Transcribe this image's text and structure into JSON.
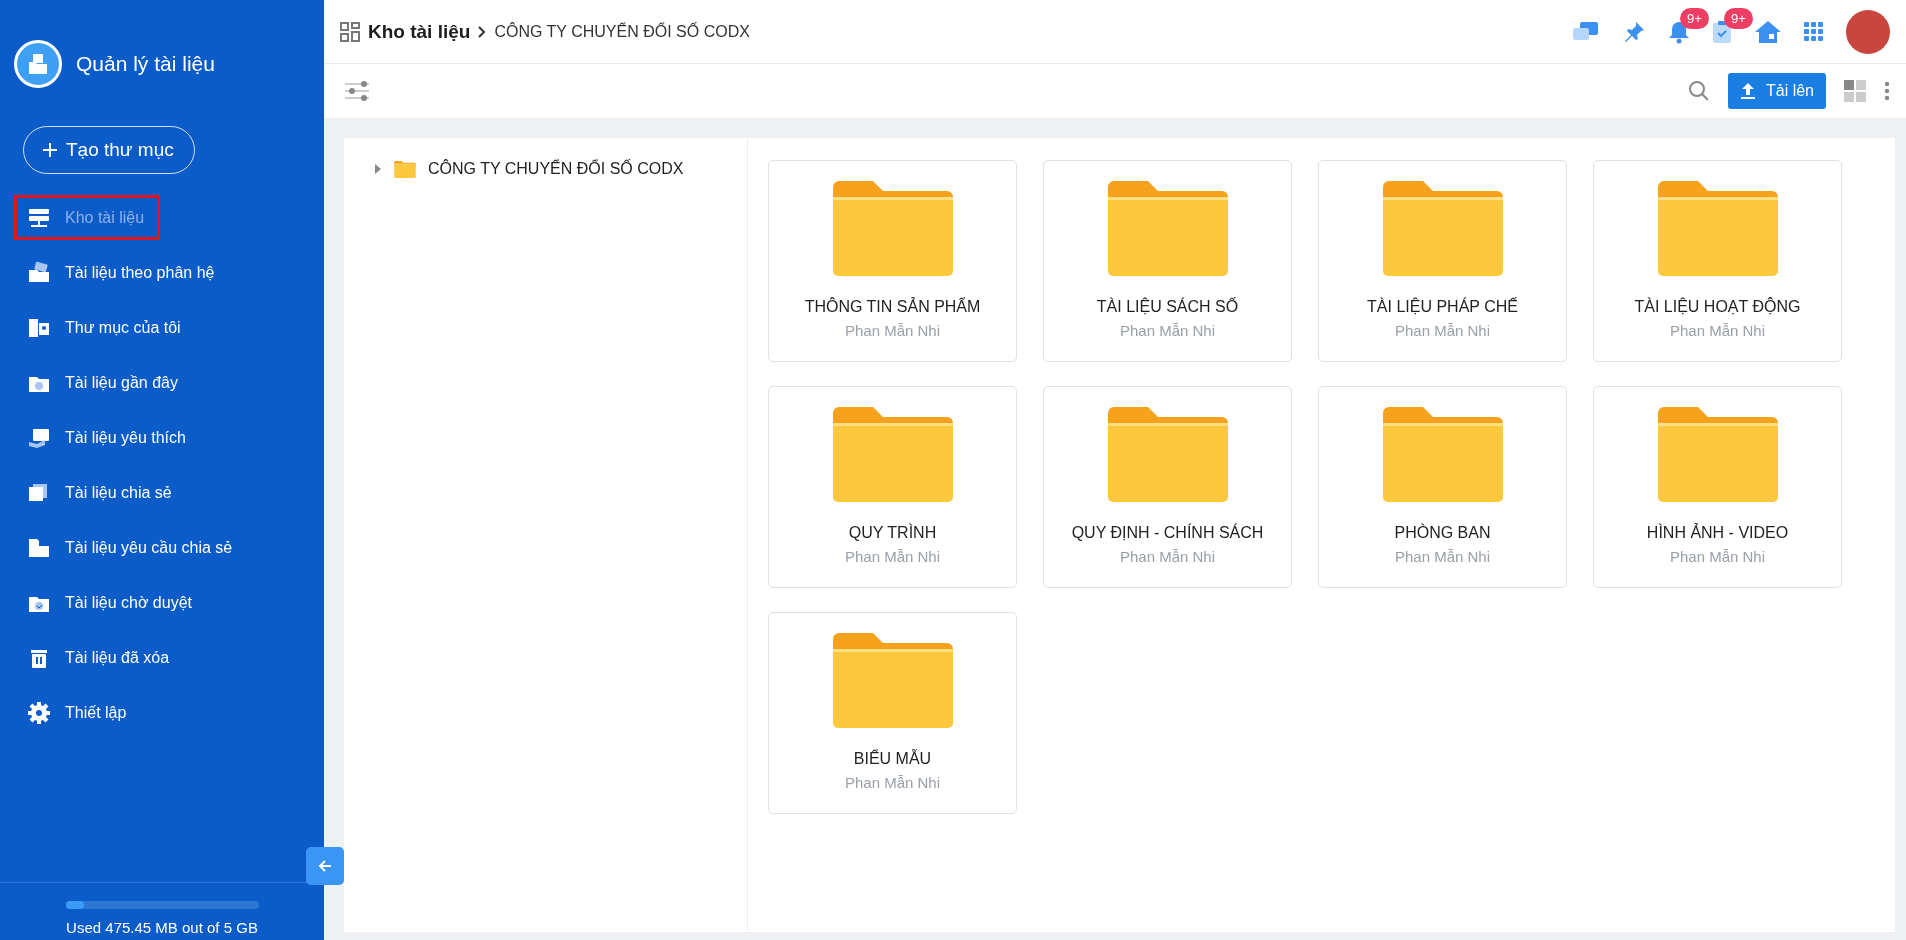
{
  "sidebar": {
    "title": "Quản lý tài liệu",
    "create_button": "Tạo thư mục",
    "items": [
      {
        "label": "Kho tài liệu",
        "selected": true
      },
      {
        "label": "Tài liệu theo phân hệ",
        "selected": false
      },
      {
        "label": "Thư mục của tôi",
        "selected": false
      },
      {
        "label": "Tài liệu gần đây",
        "selected": false
      },
      {
        "label": "Tài liệu yêu thích",
        "selected": false
      },
      {
        "label": "Tài liệu chia sẻ",
        "selected": false
      },
      {
        "label": "Tài liệu yêu cầu chia sẻ",
        "selected": false
      },
      {
        "label": "Tài liệu chờ duyệt",
        "selected": false
      },
      {
        "label": "Tài liệu đã xóa",
        "selected": false
      },
      {
        "label": "Thiết lập",
        "selected": false
      }
    ],
    "storage": {
      "level": 0.095,
      "text": "Used 475.45 MB out of 5 GB"
    }
  },
  "breadcrumb": {
    "root": "Kho tài liệu",
    "current": "CÔNG TY CHUYỂN ĐỔI SỐ CODX"
  },
  "header": {
    "notification_badge": "9+",
    "task_badge": "9+"
  },
  "toolbar": {
    "upload_button": "Tải lên"
  },
  "tree": [
    {
      "label": "CÔNG TY CHUYỂN ĐỔI SỐ CODX",
      "expanded": false
    }
  ],
  "folders": [
    {
      "name": "THÔNG TIN SẢN PHẨM",
      "owner": "Phan Mẫn Nhi"
    },
    {
      "name": "TÀI LIỆU SÁCH SỐ",
      "owner": "Phan Mẫn Nhi"
    },
    {
      "name": "TÀI LIỆU PHÁP CHẾ",
      "owner": "Phan Mẫn Nhi"
    },
    {
      "name": "TÀI LIỆU HOẠT ĐỘNG",
      "owner": "Phan Mẫn Nhi"
    },
    {
      "name": "QUY TRÌNH",
      "owner": "Phan Mẫn Nhi"
    },
    {
      "name": "QUY ĐỊNH - CHÍNH SÁCH",
      "owner": "Phan Mẫn Nhi"
    },
    {
      "name": "PHÒNG BAN",
      "owner": "Phan Mẫn Nhi"
    },
    {
      "name": "HÌNH ẢNH - VIDEO",
      "owner": "Phan Mẫn Nhi"
    },
    {
      "name": "BIỂU MẪU",
      "owner": "Phan Mẫn Nhi"
    }
  ]
}
